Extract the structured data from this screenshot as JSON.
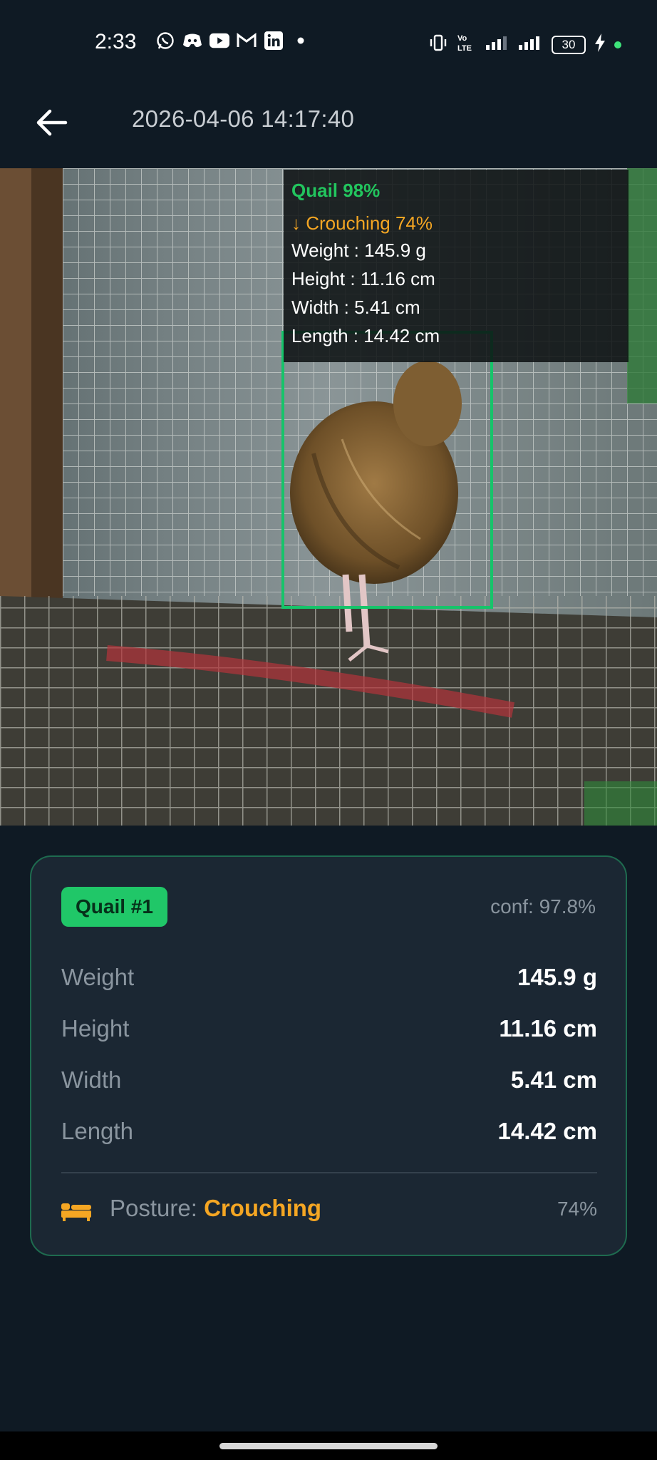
{
  "status_bar": {
    "time": "2:33",
    "app_icons": [
      "whatsapp-icon",
      "discord-icon",
      "youtube-icon",
      "gmail-icon",
      "linkedin-icon",
      "more-dot-icon"
    ],
    "battery": "30",
    "network_label": "Vo LTE"
  },
  "header": {
    "title": "2026-04-06  14:17:40",
    "back_icon": "back-arrow-icon"
  },
  "detection_overlay": {
    "species": "Quail  98%",
    "posture": "↓ Crouching  74%",
    "weight": "Weight : 145.9 g",
    "height": "Height : 11.16 cm",
    "width": "Width  : 5.41 cm",
    "length": "Length : 14.42 cm",
    "box_color": "#16c46a"
  },
  "card": {
    "badge": "Quail #1",
    "confidence": "conf: 97.8%",
    "measurements": [
      {
        "label": "Weight",
        "value": "145.9 g"
      },
      {
        "label": "Height",
        "value": "11.16 cm"
      },
      {
        "label": "Width",
        "value": "5.41 cm"
      },
      {
        "label": "Length",
        "value": "14.42 cm"
      }
    ],
    "posture_label": "Posture: ",
    "posture_value": "Crouching",
    "posture_confidence": "74%",
    "posture_icon": "bed-icon"
  },
  "colors": {
    "accent_green": "#20c768",
    "accent_orange": "#f5a623",
    "background": "#0f1a24",
    "card": "#1b2733"
  }
}
